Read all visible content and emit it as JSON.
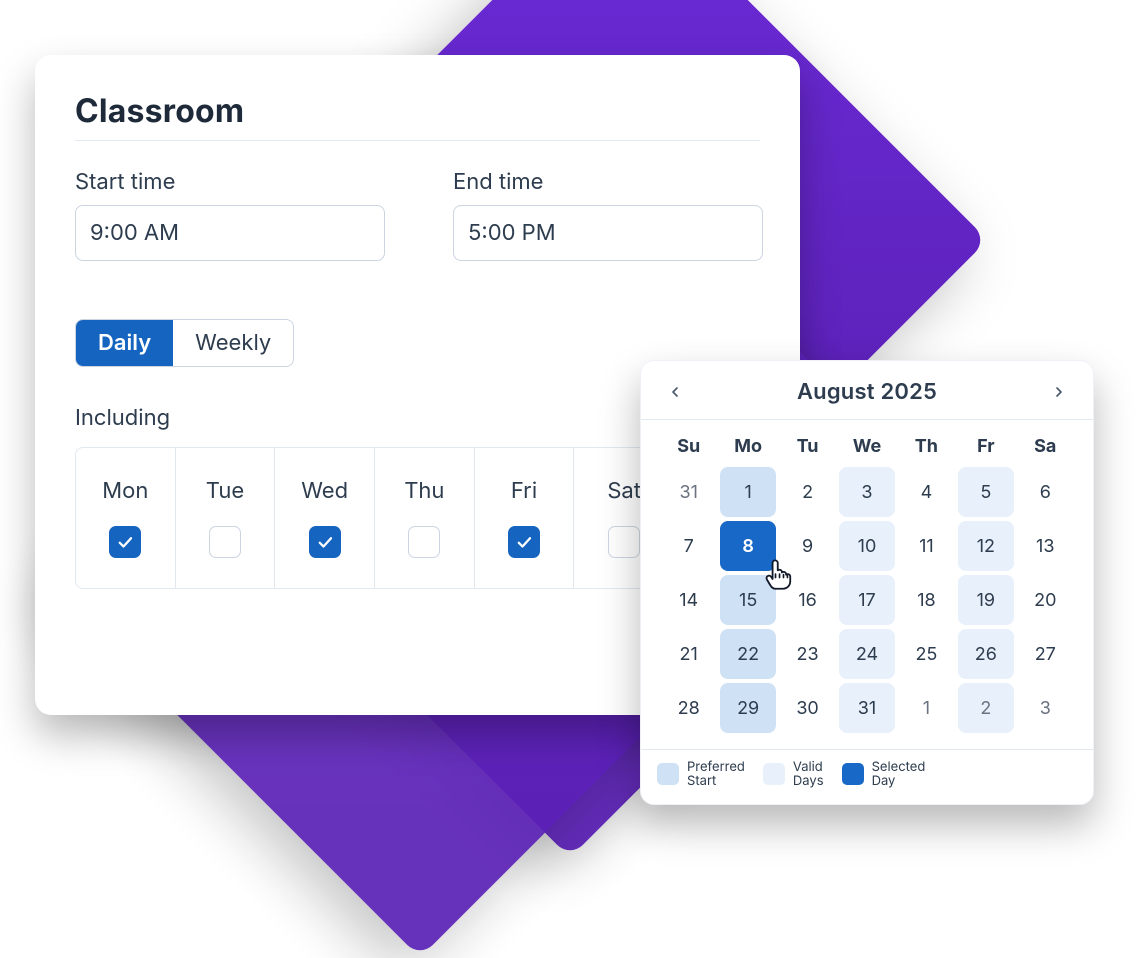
{
  "classroom": {
    "title": "Classroom",
    "start_label": "Start time",
    "end_label": "End time",
    "start_value": "9:00 AM",
    "end_value": "5:00 PM",
    "seg_daily": "Daily",
    "seg_weekly": "Weekly",
    "active_segment": "Daily",
    "including_label": "Including",
    "days": [
      {
        "label": "Mon",
        "checked": true
      },
      {
        "label": "Tue",
        "checked": false
      },
      {
        "label": "Wed",
        "checked": true
      },
      {
        "label": "Thu",
        "checked": false
      },
      {
        "label": "Fri",
        "checked": true
      },
      {
        "label": "Sat",
        "checked": false
      }
    ]
  },
  "calendar": {
    "month_title": "August 2025",
    "dow": [
      "Su",
      "Mo",
      "Tu",
      "We",
      "Th",
      "Fr",
      "Sa"
    ],
    "legend": {
      "preferred": "Preferred\nStart",
      "valid": "Valid\nDays",
      "selected": "Selected\nDay"
    },
    "weeks": [
      [
        {
          "n": "31",
          "kind": "out"
        },
        {
          "n": "1",
          "kind": "pref"
        },
        {
          "n": "2",
          "kind": "none"
        },
        {
          "n": "3",
          "kind": "valid"
        },
        {
          "n": "4",
          "kind": "none"
        },
        {
          "n": "5",
          "kind": "valid"
        },
        {
          "n": "6",
          "kind": "none"
        }
      ],
      [
        {
          "n": "7",
          "kind": "none"
        },
        {
          "n": "8",
          "kind": "selected"
        },
        {
          "n": "9",
          "kind": "none"
        },
        {
          "n": "10",
          "kind": "valid"
        },
        {
          "n": "11",
          "kind": "none"
        },
        {
          "n": "12",
          "kind": "valid"
        },
        {
          "n": "13",
          "kind": "none"
        }
      ],
      [
        {
          "n": "14",
          "kind": "none"
        },
        {
          "n": "15",
          "kind": "pref"
        },
        {
          "n": "16",
          "kind": "none"
        },
        {
          "n": "17",
          "kind": "valid"
        },
        {
          "n": "18",
          "kind": "none"
        },
        {
          "n": "19",
          "kind": "valid"
        },
        {
          "n": "20",
          "kind": "none"
        }
      ],
      [
        {
          "n": "21",
          "kind": "none"
        },
        {
          "n": "22",
          "kind": "pref"
        },
        {
          "n": "23",
          "kind": "none"
        },
        {
          "n": "24",
          "kind": "valid"
        },
        {
          "n": "25",
          "kind": "none"
        },
        {
          "n": "26",
          "kind": "valid"
        },
        {
          "n": "27",
          "kind": "none"
        }
      ],
      [
        {
          "n": "28",
          "kind": "none"
        },
        {
          "n": "29",
          "kind": "pref"
        },
        {
          "n": "30",
          "kind": "none"
        },
        {
          "n": "31",
          "kind": "valid"
        },
        {
          "n": "1",
          "kind": "out"
        },
        {
          "n": "2",
          "kind": "out-valid"
        },
        {
          "n": "3",
          "kind": "out"
        }
      ]
    ]
  }
}
